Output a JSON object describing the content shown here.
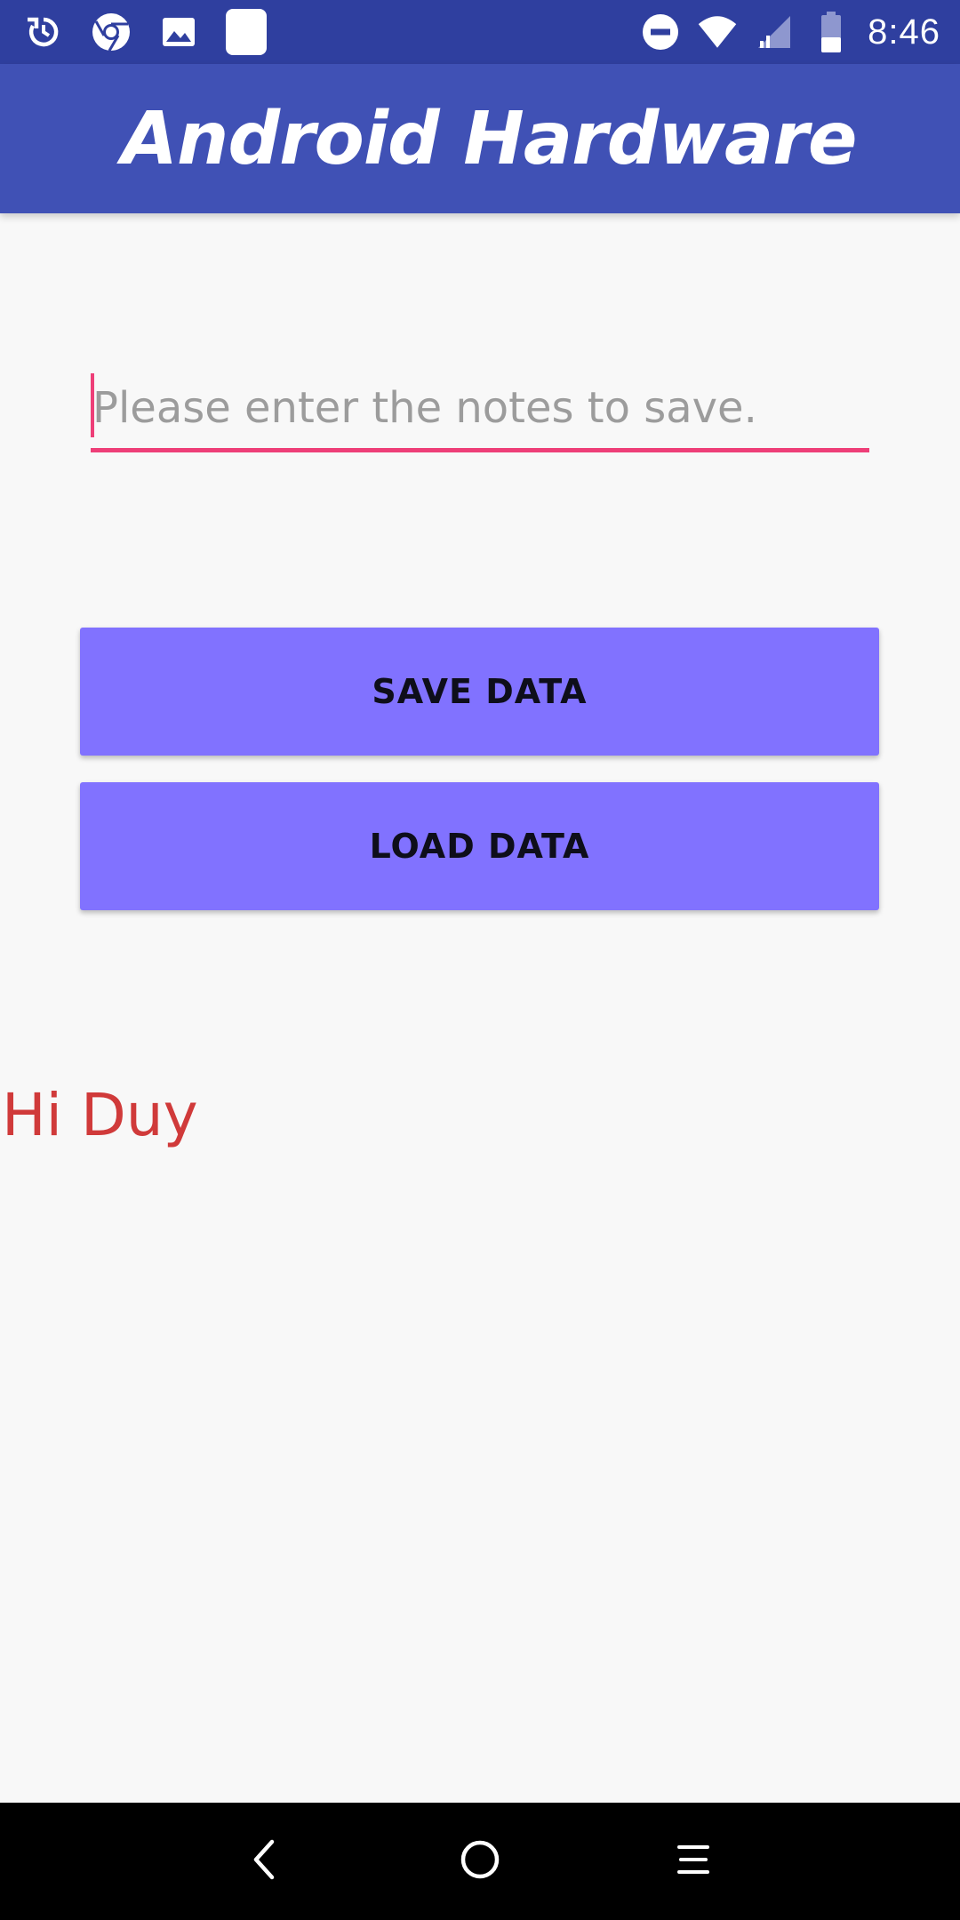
{
  "status_bar": {
    "left_icons": [
      "sync-icon",
      "chrome-icon",
      "image-icon",
      "app-square-icon"
    ],
    "right_icons": [
      "do-not-disturb-icon",
      "wifi-icon",
      "signal-icon",
      "battery-icon"
    ],
    "time": "8:46"
  },
  "app_bar": {
    "title": "Android Hardware"
  },
  "notes": {
    "placeholder": "Please enter the notes to save.",
    "value": ""
  },
  "buttons": {
    "save_label": "SAVE DATA",
    "load_label": "LOAD DATA"
  },
  "greeting": {
    "text": "Hi Duy"
  },
  "nav_bar": {
    "icons": [
      "back-icon",
      "home-icon",
      "recents-icon"
    ]
  },
  "colors": {
    "status_bar": "#2f3f9f",
    "app_bar": "#4051b5",
    "accent": "#ee3f78",
    "button": "#8172ff",
    "greeting": "#d03a3a",
    "background": "#f8f8f8"
  }
}
